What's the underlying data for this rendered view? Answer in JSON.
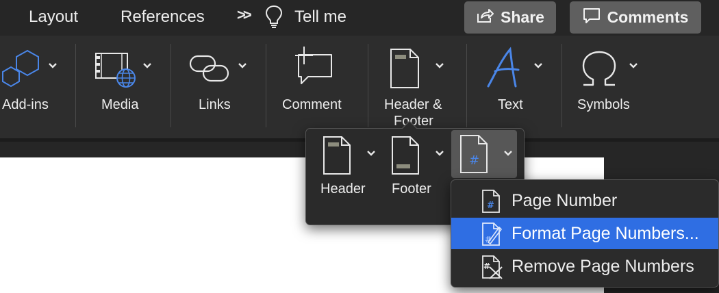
{
  "tabs": [
    {
      "label": "Layout"
    },
    {
      "label": "References"
    }
  ],
  "tell_me": {
    "label": "Tell me"
  },
  "share_button": {
    "label": "Share"
  },
  "comments_button": {
    "label": "Comments"
  },
  "ribbon": {
    "groups": [
      {
        "label": "Add-ins",
        "icon": "add-ins-icon"
      },
      {
        "label": "Media",
        "icon": "media-icon"
      },
      {
        "label": "Links",
        "icon": "link-icon"
      },
      {
        "label": "Comment",
        "icon": "comment-icon"
      },
      {
        "label_line1": "Header &",
        "label_line2": "Footer",
        "icon": "header-footer-icon"
      },
      {
        "label": "Text",
        "icon": "text-icon"
      },
      {
        "label": "Symbols",
        "icon": "omega-icon"
      }
    ]
  },
  "header_footer_popover": {
    "items": [
      {
        "label": "Header",
        "icon": "header-page-icon"
      },
      {
        "label": "Footer",
        "icon": "footer-page-icon"
      },
      {
        "label": "",
        "icon": "page-number-icon"
      }
    ]
  },
  "page_number_menu": {
    "items": [
      {
        "label": "Page Number",
        "icon": "page-number-icon",
        "highlighted": false
      },
      {
        "label": "Format Page Numbers...",
        "icon": "format-page-numbers-icon",
        "highlighted": true
      },
      {
        "label": "Remove Page Numbers",
        "icon": "remove-page-numbers-icon",
        "highlighted": false
      }
    ]
  },
  "colors": {
    "background": "#262626",
    "ribbon": "#2d2d2d",
    "button": "#5f5f5f",
    "highlight": "#2f6ee3",
    "accent_icon": "#4a86e8"
  }
}
